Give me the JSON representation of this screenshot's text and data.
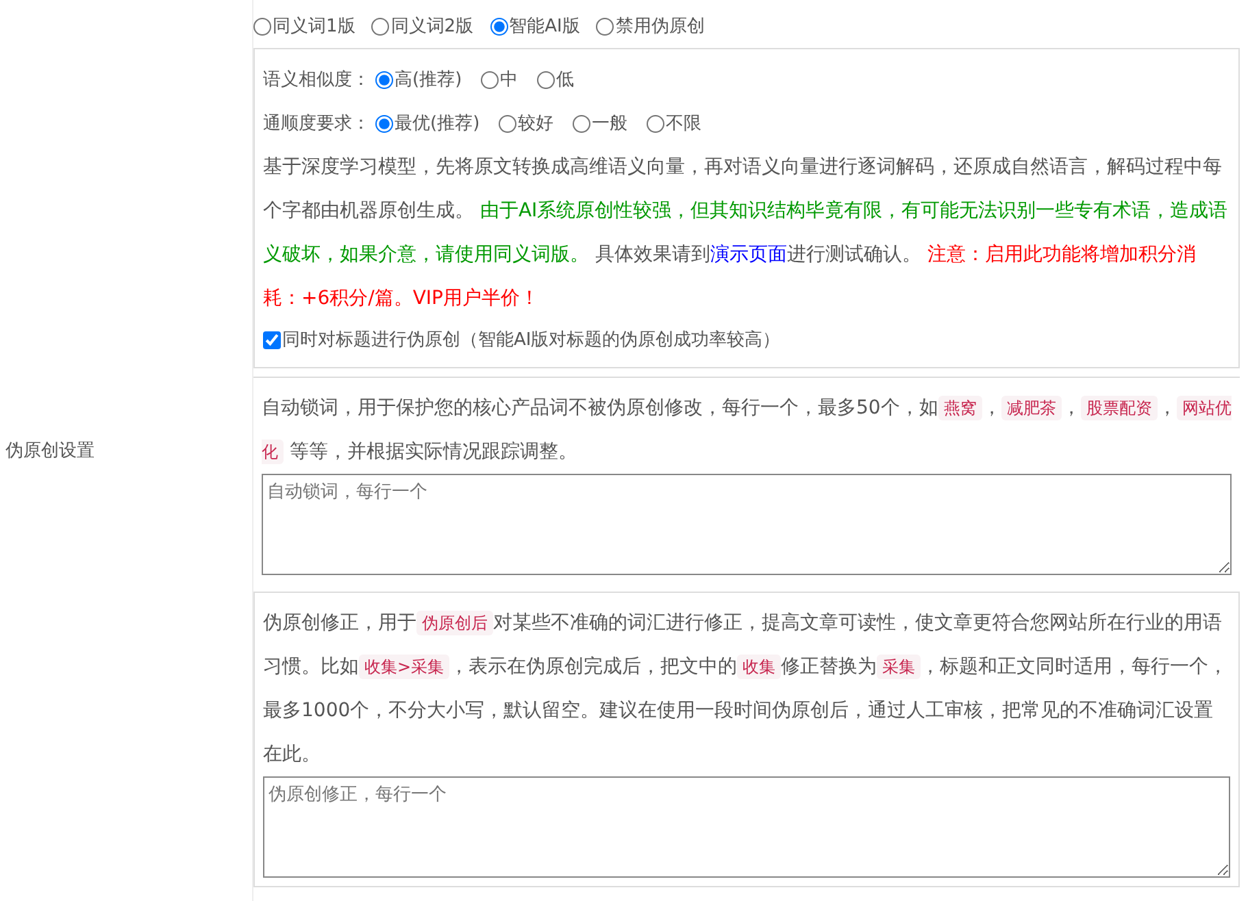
{
  "section_label": "伪原创设置",
  "modes": [
    {
      "label": "同义词1版",
      "selected": false
    },
    {
      "label": "同义词2版",
      "selected": false
    },
    {
      "label": "智能AI版",
      "selected": true
    },
    {
      "label": "禁用伪原创",
      "selected": false
    }
  ],
  "similarity": {
    "label": "语义相似度：",
    "options": [
      {
        "label": "高(推荐)",
        "selected": true
      },
      {
        "label": "中",
        "selected": false
      },
      {
        "label": "低",
        "selected": false
      }
    ]
  },
  "fluency": {
    "label": "通顺度要求：",
    "options": [
      {
        "label": "最优(推荐)",
        "selected": true
      },
      {
        "label": "较好",
        "selected": false
      },
      {
        "label": "一般",
        "selected": false
      },
      {
        "label": "不限",
        "selected": false
      }
    ]
  },
  "ai_description": [
    {
      "kind": "text",
      "text": "基于深度学习模型，先将原文转换成高维语义向量，再对语义向量进行逐词解码，还原成自然语言，解码过程中每个字都由机器原创生成。 "
    },
    {
      "kind": "green",
      "text": "由于AI系统原创性较强，但其知识结构毕竟有限，有可能无法识别一些专有术语，造成语义破坏，如果介意，请使用同义词版。"
    },
    {
      "kind": "text",
      "text": " 具体效果请到"
    },
    {
      "kind": "link",
      "text": "演示页面"
    },
    {
      "kind": "text",
      "text": "进行测试确认。 "
    },
    {
      "kind": "red",
      "text": "注意：启用此功能将增加积分消耗：+6积分/篇。VIP用户半价！"
    }
  ],
  "title_option": {
    "label": "同时对标题进行伪原创（智能AI版对标题的伪原创成功率较高）",
    "checked": true
  },
  "lock_words": {
    "description": [
      {
        "kind": "text",
        "text": "自动锁词，用于保护您的核心产品词不被伪原创修改，每行一个，最多50个，如"
      },
      {
        "kind": "tag",
        "text": "燕窝"
      },
      {
        "kind": "text",
        "text": "，"
      },
      {
        "kind": "tag",
        "text": "减肥茶"
      },
      {
        "kind": "text",
        "text": "，"
      },
      {
        "kind": "tag",
        "text": "股票配资"
      },
      {
        "kind": "text",
        "text": "，"
      },
      {
        "kind": "tag",
        "text": "网站优化"
      },
      {
        "kind": "text",
        "text": " 等等，并根据实际情况跟踪调整。"
      }
    ],
    "placeholder": "自动锁词，每行一个"
  },
  "corrections": {
    "description": [
      {
        "kind": "text",
        "text": "伪原创修正，用于"
      },
      {
        "kind": "tag",
        "text": "伪原创后"
      },
      {
        "kind": "text",
        "text": "对某些不准确的词汇进行修正，提高文章可读性，使文章更符合您网站所在行业的用语习惯。比如"
      },
      {
        "kind": "tag",
        "text": "收集>采集"
      },
      {
        "kind": "text",
        "text": "，表示在伪原创完成后，把文中的"
      },
      {
        "kind": "tag",
        "text": "收集"
      },
      {
        "kind": "text",
        "text": "修正替换为"
      },
      {
        "kind": "tag",
        "text": "采集"
      },
      {
        "kind": "text",
        "text": "，标题和正文同时适用，每行一个，最多1000个，不分大小写，默认留空。建议在使用一段时间伪原创后，通过人工审核，把常见的不准确词汇设置在此。"
      }
    ],
    "placeholder": "伪原创修正，每行一个"
  }
}
